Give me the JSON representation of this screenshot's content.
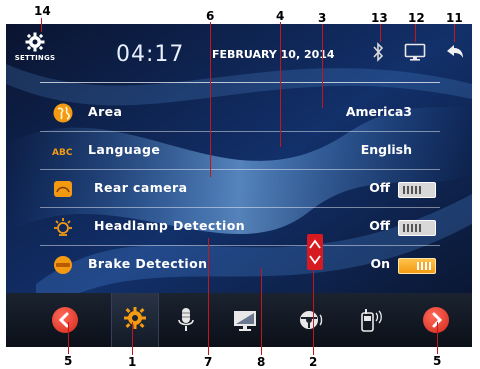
{
  "callouts": {
    "c14": "14",
    "c6": "6",
    "c4": "4",
    "c3": "3",
    "c13": "13",
    "c12": "12",
    "c11": "11",
    "c5_left": "5",
    "c1": "1",
    "c7": "7",
    "c8": "8",
    "c2": "2",
    "c5_right": "5"
  },
  "header": {
    "settings_label": "SETTINGS",
    "time": "04:17",
    "date": "FEBRUARY 10, 2014"
  },
  "rows": [
    {
      "label": "Area",
      "value": "America3",
      "icon": "globe-icon"
    },
    {
      "label": "Language",
      "value": "English",
      "icon": "abc-icon"
    },
    {
      "label": "Rear camera",
      "value": "Off",
      "toggle": "off",
      "icon": "camera-icon"
    },
    {
      "label": "Headlamp Detection",
      "value": "Off",
      "toggle": "off",
      "icon": "headlamp-icon"
    },
    {
      "label": "Brake Detection",
      "value": "On",
      "toggle": "on",
      "icon": "brake-icon"
    }
  ],
  "bottom_bar": {
    "icons": [
      "chevron-left-icon",
      "gear-icon",
      "microphone-icon",
      "display-icon",
      "steering-wheel-icon",
      "phone-icon",
      "chevron-right-icon"
    ]
  },
  "colors": {
    "accent_red": "#d71920",
    "orange": "#f39a12",
    "screen_bg": "#0a1634"
  }
}
